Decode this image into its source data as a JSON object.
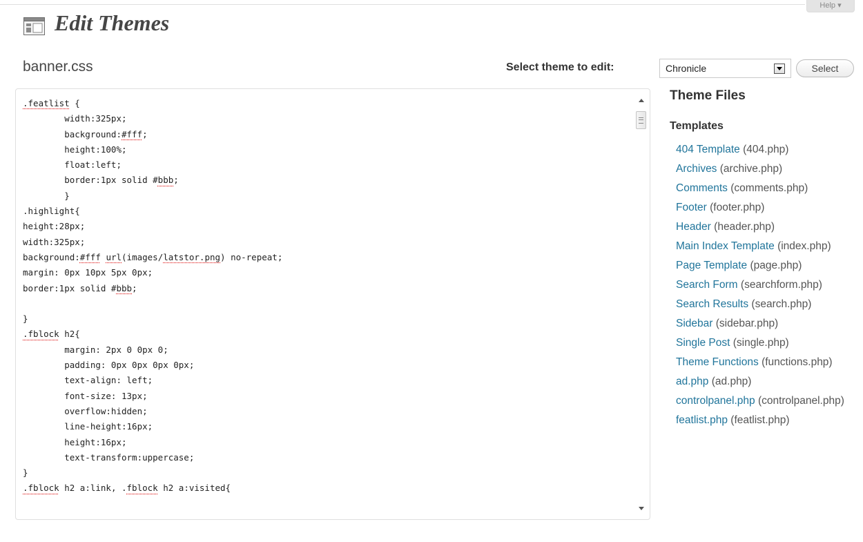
{
  "header": {
    "help_label": "Help ▾",
    "title": "Edit Themes"
  },
  "editor": {
    "file_name": "banner.css",
    "code_lines": [
      [
        {
          "t": ".featlist",
          "s": true
        },
        {
          "t": " {"
        }
      ],
      [
        {
          "t": "        width:325px;"
        }
      ],
      [
        {
          "t": "        background:"
        },
        {
          "t": "#fff",
          "s": true
        },
        {
          "t": ";"
        }
      ],
      [
        {
          "t": "        height:100%;"
        }
      ],
      [
        {
          "t": "        float:left;"
        }
      ],
      [
        {
          "t": "        border:1px solid #"
        },
        {
          "t": "bbb",
          "s": true
        },
        {
          "t": ";"
        }
      ],
      [
        {
          "t": "        }"
        }
      ],
      [
        {
          "t": ".highlight{"
        }
      ],
      [
        {
          "t": "height:28px;"
        }
      ],
      [
        {
          "t": "width:325px;"
        }
      ],
      [
        {
          "t": "background:"
        },
        {
          "t": "#fff",
          "s": true
        },
        {
          "t": " "
        },
        {
          "t": "url",
          "s": true
        },
        {
          "t": "(images/"
        },
        {
          "t": "latstor.png",
          "s": true
        },
        {
          "t": ") no-repeat;"
        }
      ],
      [
        {
          "t": "margin: 0px 10px 5px 0px;"
        }
      ],
      [
        {
          "t": "border:1px solid #"
        },
        {
          "t": "bbb",
          "s": true
        },
        {
          "t": ";"
        }
      ],
      [
        {
          "t": ""
        }
      ],
      [
        {
          "t": "}"
        }
      ],
      [
        {
          "t": ".fblock",
          "s": true
        },
        {
          "t": " h2{"
        }
      ],
      [
        {
          "t": "        margin: 2px 0 0px 0;"
        }
      ],
      [
        {
          "t": "        padding: 0px 0px 0px 0px;"
        }
      ],
      [
        {
          "t": "        text-align: left;"
        }
      ],
      [
        {
          "t": "        font-size: 13px;"
        }
      ],
      [
        {
          "t": "        overflow:hidden;"
        }
      ],
      [
        {
          "t": "        line-height:16px;"
        }
      ],
      [
        {
          "t": "        height:16px;"
        }
      ],
      [
        {
          "t": "        text-transform:uppercase;"
        }
      ],
      [
        {
          "t": "}"
        }
      ],
      [
        {
          "t": ".fblock",
          "s": true
        },
        {
          "t": " h2 a:link, ."
        },
        {
          "t": "fblock",
          "s": true
        },
        {
          "t": " h2 a:visited{"
        }
      ]
    ]
  },
  "theme_selector": {
    "label": "Select theme to edit:",
    "selected": "Chronicle",
    "button_label": "Select"
  },
  "sidebar": {
    "heading": "Theme Files",
    "templates_heading": "Templates",
    "files": [
      {
        "name": "404 Template",
        "file": "(404.php)"
      },
      {
        "name": "Archives",
        "file": "(archive.php)"
      },
      {
        "name": "Comments",
        "file": "(comments.php)"
      },
      {
        "name": "Footer",
        "file": "(footer.php)"
      },
      {
        "name": "Header",
        "file": "(header.php)"
      },
      {
        "name": "Main Index Template",
        "file": "(index.php)"
      },
      {
        "name": "Page Template",
        "file": "(page.php)"
      },
      {
        "name": "Search Form",
        "file": "(searchform.php)"
      },
      {
        "name": "Search Results",
        "file": "(search.php)"
      },
      {
        "name": "Sidebar",
        "file": "(sidebar.php)"
      },
      {
        "name": "Single Post",
        "file": "(single.php)"
      },
      {
        "name": "Theme Functions",
        "file": "(functions.php)"
      },
      {
        "name": "ad.php",
        "file": "(ad.php)"
      },
      {
        "name": "controlpanel.php",
        "file": "(controlpanel.php)"
      },
      {
        "name": "featlist.php",
        "file": "(featlist.php)"
      }
    ]
  }
}
